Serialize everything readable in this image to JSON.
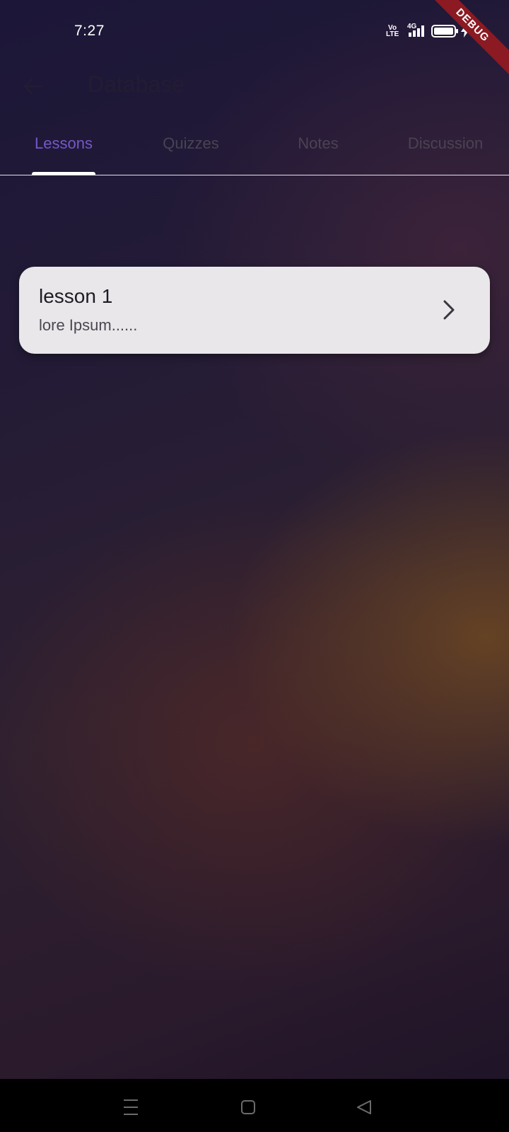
{
  "status_bar": {
    "time": "7:27",
    "volte_top": "Vo",
    "volte_bottom": "LTE",
    "network": "4G",
    "debug_label": "DEBUG"
  },
  "app_bar": {
    "title": "Database"
  },
  "tabs": [
    {
      "label": "Lessons",
      "active": true
    },
    {
      "label": "Quizzes",
      "active": false
    },
    {
      "label": "Notes",
      "active": false
    },
    {
      "label": "Discussion",
      "active": false
    }
  ],
  "lessons": [
    {
      "title": "lesson 1",
      "subtitle": "lore Ipsum......"
    }
  ],
  "colors": {
    "active_tab": "#7458c6",
    "inactive_tab": "#4a4352",
    "card_bg": "#e9e7ea",
    "debug_ribbon": "#8b1a22"
  },
  "icons": {
    "back": "arrow-left-icon",
    "chevron": "chevron-right-icon",
    "nav_recents": "menu-icon",
    "nav_home": "square-icon",
    "nav_back": "triangle-back-icon"
  }
}
